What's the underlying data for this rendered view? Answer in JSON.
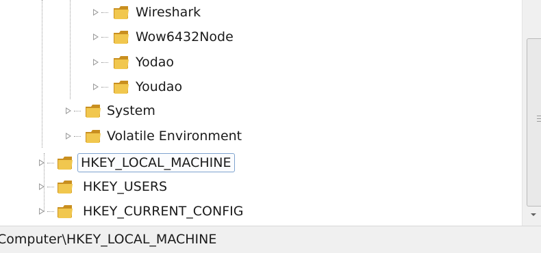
{
  "tree": {
    "nodes": [
      {
        "name": "tree-node-wireshark",
        "label": "Wireshark"
      },
      {
        "name": "tree-node-wow6432node",
        "label": "Wow6432Node"
      },
      {
        "name": "tree-node-yodao",
        "label": "Yodao"
      },
      {
        "name": "tree-node-youdao",
        "label": "Youdao"
      },
      {
        "name": "tree-node-system",
        "label": "System"
      },
      {
        "name": "tree-node-volatile-environment",
        "label": "Volatile Environment"
      },
      {
        "name": "tree-node-hkey-local-machine",
        "label": "HKEY_LOCAL_MACHINE",
        "selected": true
      },
      {
        "name": "tree-node-hkey-users",
        "label": "HKEY_USERS"
      },
      {
        "name": "tree-node-hkey-current-config",
        "label": "HKEY_CURRENT_CONFIG"
      }
    ],
    "icon": "folder-icon",
    "expander_icon": "expand-arrow-icon"
  },
  "statusbar": {
    "path": "Computer\\HKEY_LOCAL_MACHINE"
  },
  "colors": {
    "folder": "#e8b93a",
    "selection_border": "#7da2ce",
    "statusbar_bg": "#f0f0f0"
  }
}
